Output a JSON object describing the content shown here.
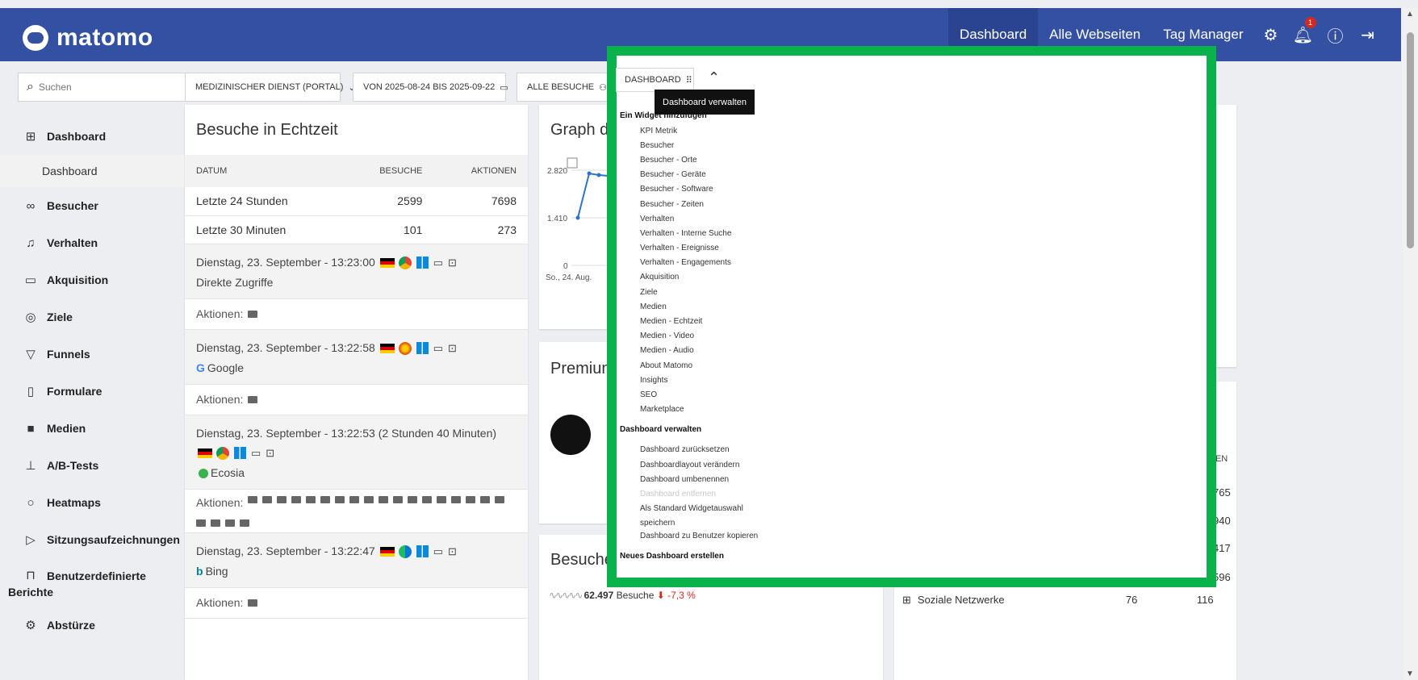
{
  "app": {
    "name": "matomo"
  },
  "topnav": {
    "dashboard": "Dashboard",
    "all_sites": "Alle Webseiten",
    "tag_manager": "Tag Manager",
    "notifications_count": "1"
  },
  "search": {
    "placeholder": "Suchen"
  },
  "filters": {
    "site": "MEDIZINISCHER DIENST (PORTAL)",
    "period": "VON 2025-08-24 BIS 2025-09-22",
    "segment": "ALLE BESUCHE",
    "dashboard": "DASHBOARD"
  },
  "tooltip": "Dashboard verwalten",
  "sidebar": {
    "items": [
      {
        "label": "Dashboard",
        "icon": "grid-icon"
      },
      {
        "label": "Dashboard",
        "sub": true
      },
      {
        "label": "Besucher",
        "icon": "users-icon"
      },
      {
        "label": "Verhalten",
        "icon": "bell-icon"
      },
      {
        "label": "Akquisition",
        "icon": "window-icon"
      },
      {
        "label": "Ziele",
        "icon": "target-icon"
      },
      {
        "label": "Funnels",
        "icon": "funnel-icon"
      },
      {
        "label": "Formulare",
        "icon": "clipboard-icon"
      },
      {
        "label": "Medien",
        "icon": "media-icon"
      },
      {
        "label": "A/B-Tests",
        "icon": "flask-icon"
      },
      {
        "label": "Heatmaps",
        "icon": "flame-icon"
      },
      {
        "label": "Sitzungsaufzeichnungen",
        "icon": "play-icon"
      },
      {
        "label": "Benutzerdefinierte Berichte",
        "icon": "report-icon"
      },
      {
        "label": "Abstürze",
        "icon": "bug-icon"
      }
    ]
  },
  "realtime": {
    "title": "Besuche in Echtzeit",
    "columns": [
      "DATUM",
      "BESUCHE",
      "AKTIONEN"
    ],
    "rows": [
      {
        "label": "Letzte 24 Stunden",
        "visits": "2599",
        "actions": "7698"
      },
      {
        "label": "Letzte 30 Minuten",
        "visits": "101",
        "actions": "273"
      }
    ],
    "actions_label": "Aktionen:",
    "visits": [
      {
        "time": "Dienstag, 23. September - 13:23:00",
        "referrer": "Direkte Zugriffe"
      },
      {
        "time": "Dienstag, 23. September - 13:22:58",
        "referrer": "Google"
      },
      {
        "time": "Dienstag, 23. September - 13:22:53 (2 Stunden 40 Minuten)",
        "referrer": "Ecosia"
      },
      {
        "time": "Dienstag, 23. September - 13:22:47",
        "referrer": "Bing"
      }
    ]
  },
  "graph": {
    "title_partial": "Graph der",
    "y_ticks": [
      "2.820",
      "1.410",
      "0"
    ],
    "x_tick": "So., 24. Aug."
  },
  "premium": {
    "title_partial": "Premium-"
  },
  "overview": {
    "title_partial": "Besucherü",
    "visits_value": "62.497",
    "visits_label": "Besuche",
    "change": "-7,3 %"
  },
  "right_widget": {
    "col_partial": "NEN",
    "values": [
      "765",
      "940",
      "417",
      "596",
      "116"
    ],
    "row_label": "Soziale Netzwerke",
    "row_value": "76"
  },
  "menu": {
    "add_widget_heading": "Ein Widget hinzufügen",
    "widgets": [
      "KPI Metrik",
      "Besucher",
      "Besucher - Orte",
      "Besucher - Geräte",
      "Besucher - Software",
      "Besucher - Zeiten",
      "Verhalten",
      "Verhalten - Interne Suche",
      "Verhalten - Ereignisse",
      "Verhalten - Engagements",
      "Akquisition",
      "Ziele",
      "Medien",
      "Medien - Echtzeit",
      "Medien - Video",
      "Medien - Audio",
      "About Matomo",
      "Insights",
      "SEO",
      "Marketplace"
    ],
    "manage_heading": "Dashboard verwalten",
    "manage_items": [
      "Dashboard zurücksetzen",
      "Dashboardlayout verändern",
      "Dashboard umbenennen",
      "Dashboard entfernen",
      "Als Standard Widgetauswahl speichern",
      "Dashboard zu Benutzer kopieren"
    ],
    "new_dashboard": "Neues Dashboard erstellen"
  },
  "colors": {
    "header": "#3450a3",
    "highlight": "#09b24a"
  }
}
